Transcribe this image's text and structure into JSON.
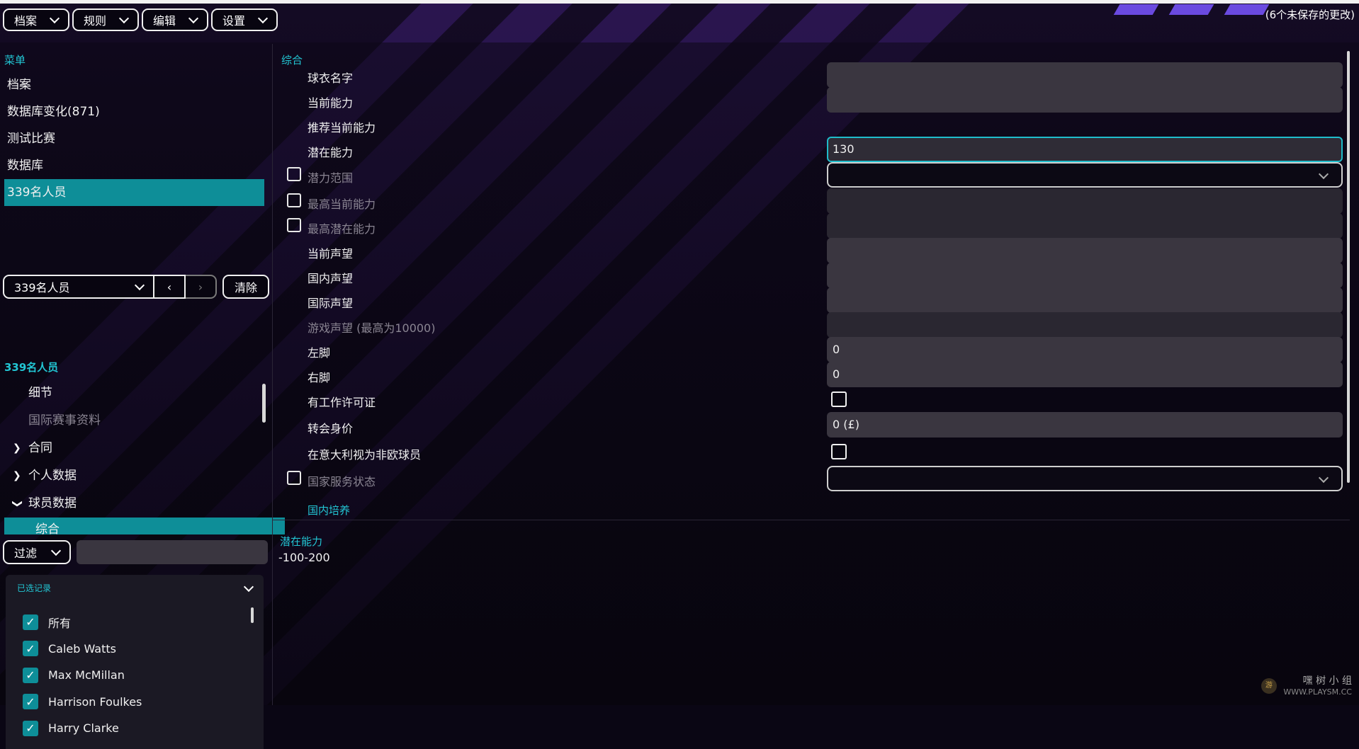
{
  "menubar": [
    "档案",
    "规则",
    "编辑",
    "设置"
  ],
  "unsaved": "(6个未保存的更改)",
  "sidebar": {
    "title": "菜单",
    "items": [
      "档案",
      "数据库变化(871)",
      "测试比赛",
      "数据库",
      "339名人员"
    ],
    "active_index": 4
  },
  "people_nav": {
    "selected": "339名人员",
    "clear": "清除"
  },
  "tree": {
    "heading": "339名人员",
    "items": [
      {
        "label": "细节",
        "state": "none"
      },
      {
        "label": "国际赛事资料",
        "state": "dim"
      },
      {
        "label": "合同",
        "state": "collapsed"
      },
      {
        "label": "个人数据",
        "state": "collapsed"
      },
      {
        "label": "球员数据",
        "state": "expanded"
      },
      {
        "label": "综合",
        "state": "selected"
      }
    ]
  },
  "filter": {
    "label": "过滤",
    "value": ""
  },
  "records": {
    "title": "已选记录",
    "items": [
      "所有",
      "Caleb Watts",
      "Max McMillan",
      "Harrison Foulkes",
      "Harry Clarke"
    ]
  },
  "main": {
    "section_title": "综合",
    "fields": [
      {
        "label": "球衣名字",
        "value": ""
      },
      {
        "label": "当前能力",
        "value": ""
      },
      {
        "label": "推荐当前能力",
        "value": ""
      },
      {
        "label": "潜在能力",
        "value": "130"
      },
      {
        "label": "潜力范围",
        "value": ""
      },
      {
        "label": "最高当前能力",
        "value": ""
      },
      {
        "label": "最高潜在能力",
        "value": ""
      },
      {
        "label": "当前声望",
        "value": ""
      },
      {
        "label": "国内声望",
        "value": ""
      },
      {
        "label": "国际声望",
        "value": ""
      },
      {
        "label": "游戏声望 (最高为10000)",
        "value": ""
      },
      {
        "label": "左脚",
        "value": "0"
      },
      {
        "label": "右脚",
        "value": "0"
      },
      {
        "label": "有工作许可证",
        "value": ""
      },
      {
        "label": "转会身价",
        "value": "0 (£)"
      },
      {
        "label": "在意大利视为非欧球员",
        "value": ""
      },
      {
        "label": "国家服务状态",
        "value": ""
      }
    ],
    "link": "国内培养",
    "help": {
      "title": "潜在能力",
      "range": "-100-200"
    }
  },
  "watermark": {
    "logo": "游",
    "cn": "嘿 树 小 组",
    "url": "WWW.PLAYSM.CC"
  },
  "colors": {
    "accent": "#22c6d4",
    "selection": "#0e8e98",
    "bg": "#0c0618"
  }
}
